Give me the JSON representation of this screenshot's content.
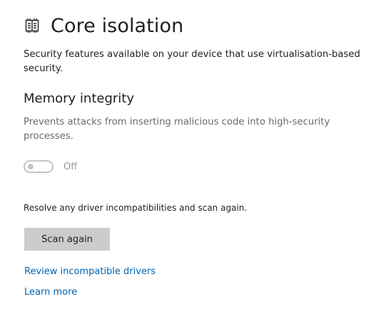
{
  "header": {
    "icon": "chip-icon",
    "title": "Core isolation"
  },
  "intro": {
    "text": "Security features available on your device that use virtualisation-based security."
  },
  "memory_integrity": {
    "title": "Memory integrity",
    "description": "Prevents attacks from inserting malicious code into high-security processes.",
    "toggle_state": "Off",
    "toggle_on": false
  },
  "resolve": {
    "text": "Resolve any driver incompatibilities and scan again."
  },
  "actions": {
    "scan_again_label": "Scan again"
  },
  "links": {
    "review_drivers": "Review incompatible drivers",
    "learn_more": "Learn more"
  },
  "colors": {
    "link": "#0063b1",
    "button_bg": "#cccccc",
    "toggle_disabled": "#c6c6c6"
  }
}
